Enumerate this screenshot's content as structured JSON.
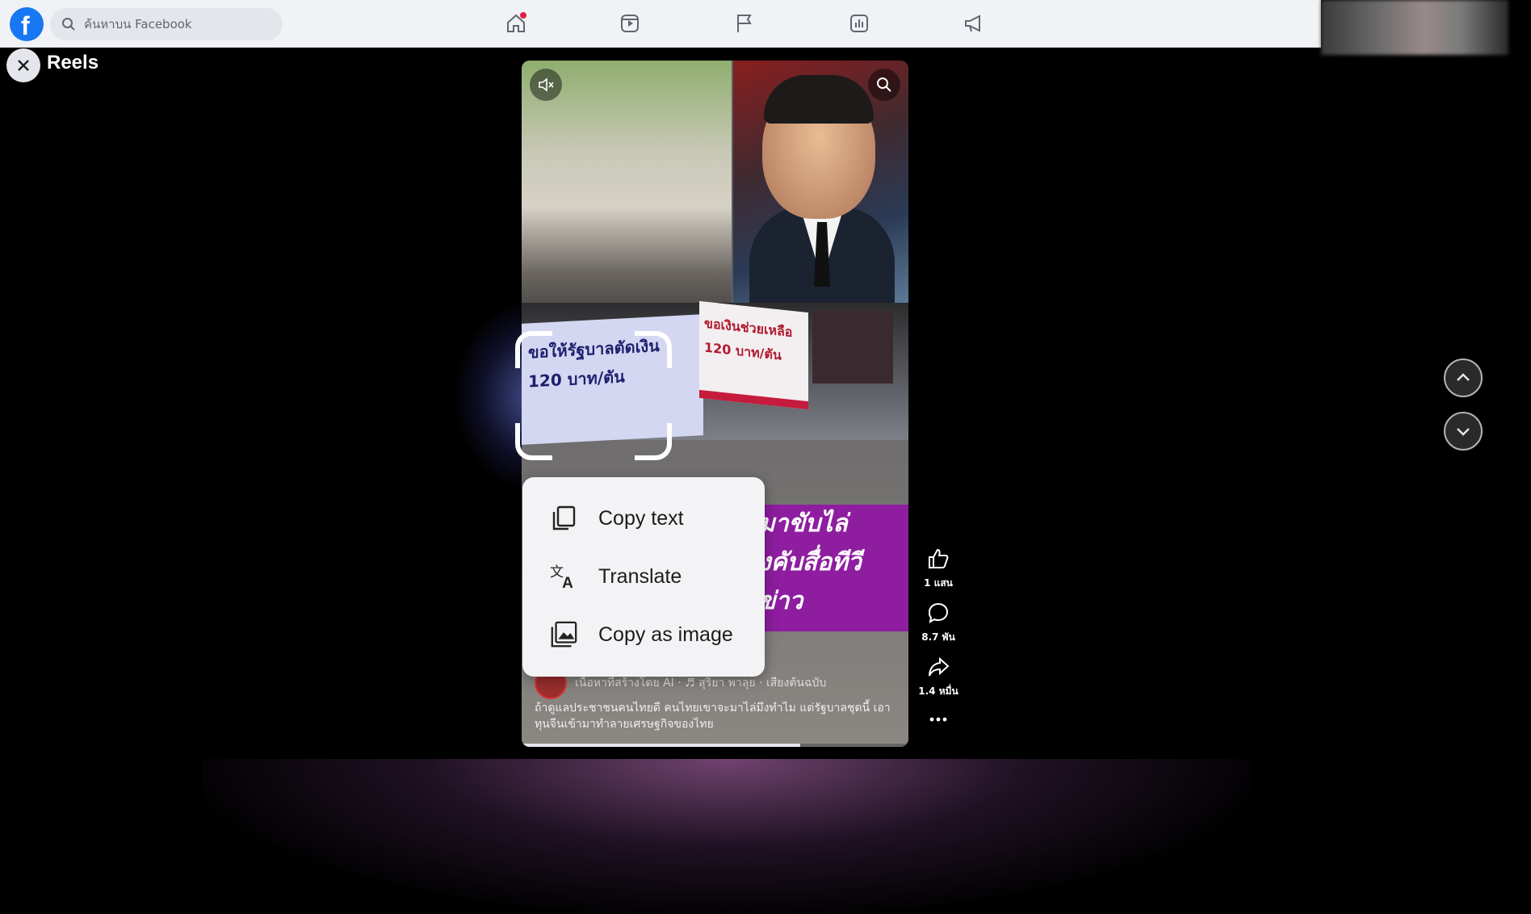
{
  "search": {
    "placeholder": "ค้นหาบน Facebook"
  },
  "page": {
    "title": "Reels"
  },
  "video": {
    "banner_left_text": "ขอให้รัฐบาลตัดเงิน 120 บาท/ตัน",
    "banner_mid_text": "ขอเงินช่วยเหลือ 120 บาท/ตัน",
    "overlay_text": [
      "มาขับไล่",
      "งคับสื่อทีวี",
      "ข่าว"
    ],
    "author_line": "เนื้อหาที่สร้างโดย AI · ♬ สุริยา พาลุย · เสียงต้นฉบับ",
    "caption": "ถ้าดูแลประชาชนคนไทยดี คนไทยเขาจะมาไล่มึงทำไม แต่รัฐบาลชุดนี้ เอาทุนจีนเข้ามาทำลายเศรษฐกิจของไทย",
    "progress_fraction": 0.72
  },
  "context_menu": {
    "items": [
      {
        "label": "Copy text",
        "icon": "copy-icon"
      },
      {
        "label": "Translate",
        "icon": "translate-icon"
      },
      {
        "label": "Copy as image",
        "icon": "image-icon"
      }
    ]
  },
  "actions": {
    "likes": "1 แสน",
    "comments": "8.7 พัน",
    "shares": "1.4 หมื่น"
  },
  "colors": {
    "brand": "#1877f2",
    "overlay_purple": "#8e1da0",
    "notification": "#e41e3f"
  }
}
